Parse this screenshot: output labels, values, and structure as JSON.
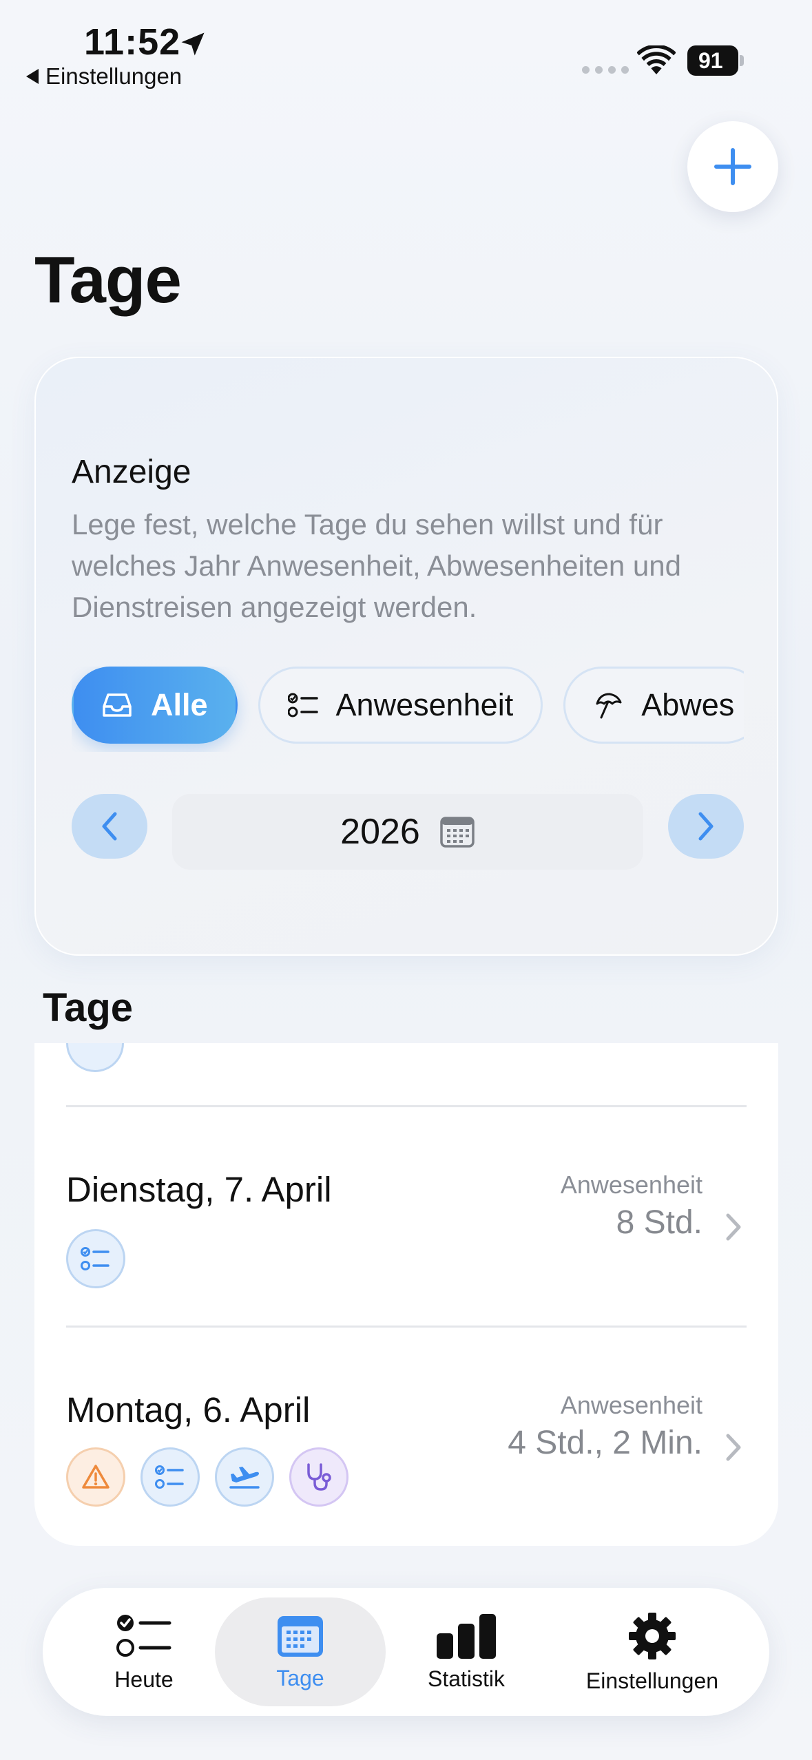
{
  "status_bar": {
    "time": "11:52",
    "back_label": "Einstellungen",
    "battery": "91"
  },
  "header": {
    "title": "Tage",
    "add_icon": "plus-icon"
  },
  "filter_card": {
    "heading": "Anzeige",
    "description": "Lege fest, welche Tage du sehen willst und für welches Jahr Anwesenheit, Abwesenheiten und Dienstreisen angezeigt werden.",
    "chips": [
      {
        "label": "Alle",
        "icon": "inbox-icon",
        "active": true
      },
      {
        "label": "Anwesenheit",
        "icon": "checklist-icon",
        "active": false
      },
      {
        "label": "Abwes",
        "icon": "umbrella-icon",
        "active": false
      }
    ],
    "year": "2026"
  },
  "days_section": {
    "title": "Tage",
    "days": [
      {
        "date": "Dienstag, 7. April",
        "kind": "Anwesenheit",
        "hours": "8 Std.",
        "badges": [
          "checklist-icon"
        ]
      },
      {
        "date": "Montag, 6. April",
        "kind": "Anwesenheit",
        "hours": "4 Std., 2 Min.",
        "badges": [
          "warning-icon",
          "checklist-icon",
          "airplane-icon",
          "stethoscope-icon"
        ]
      }
    ]
  },
  "colors": {
    "accent": "#3E8EF0",
    "warning": "#EE8A3C",
    "medical": "#7A5CD6"
  },
  "tab_bar": {
    "tabs": [
      {
        "label": "Heute",
        "icon": "checklist-icon",
        "active": false
      },
      {
        "label": "Tage",
        "icon": "calendar-icon",
        "active": true
      },
      {
        "label": "Statistik",
        "icon": "bar-chart-icon",
        "active": false
      },
      {
        "label": "Einstellungen",
        "icon": "gear-icon",
        "active": false
      }
    ]
  }
}
